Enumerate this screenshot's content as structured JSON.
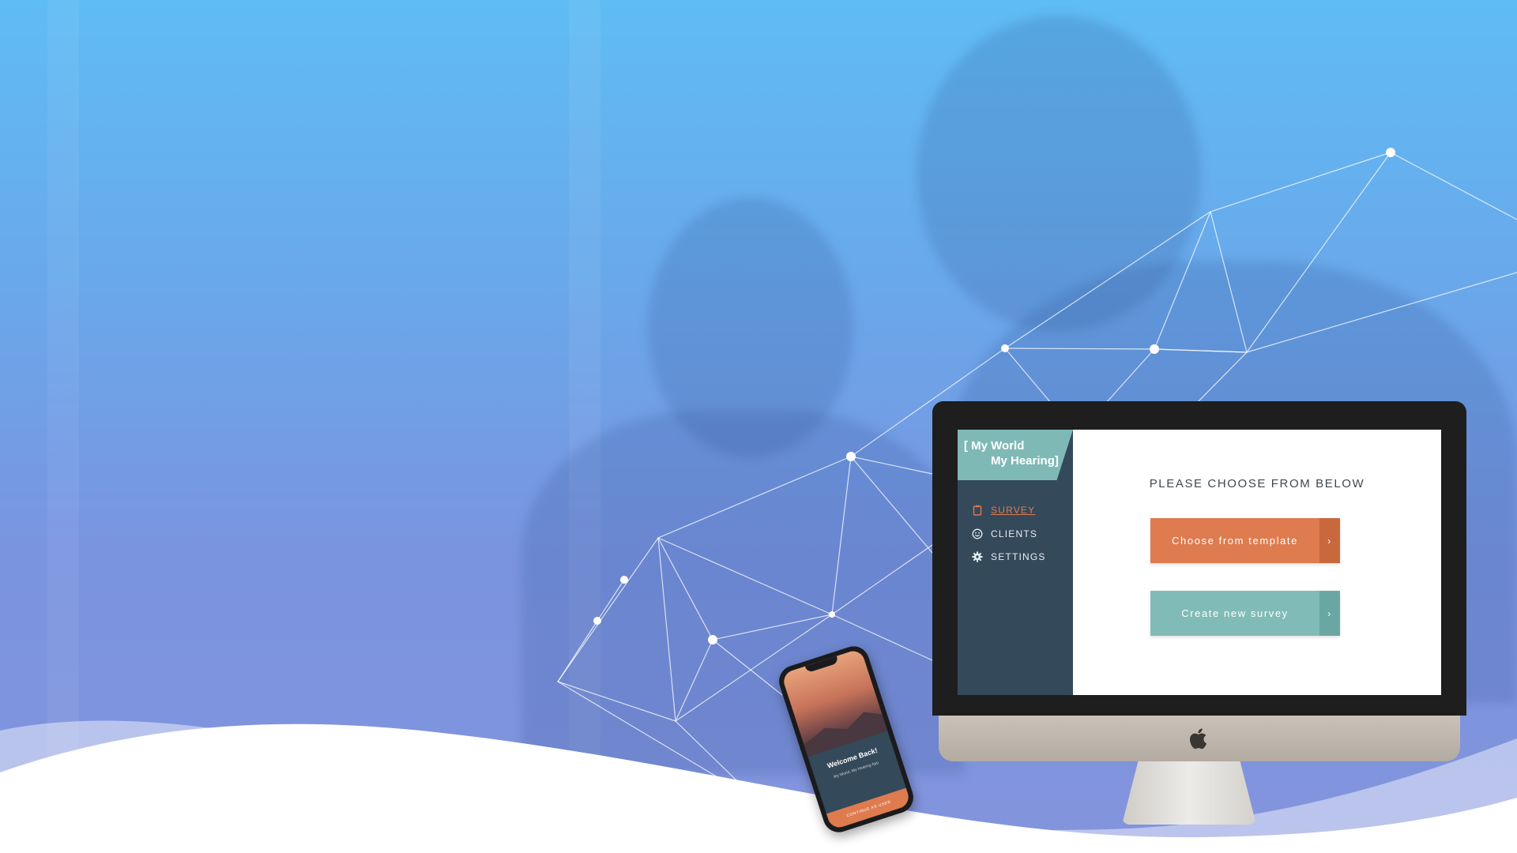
{
  "colors": {
    "accent_orange": "#de7b4f",
    "accent_teal": "#80bbb7",
    "sidebar": "#34495a",
    "background_top": "#5fbcf4",
    "background_bottom": "#8394dc"
  },
  "app": {
    "brand_line1": "[ My World",
    "brand_line2": "My Hearing]",
    "nav": [
      {
        "label": "SURVEY",
        "icon": "clipboard-icon",
        "active": true
      },
      {
        "label": "CLIENTS",
        "icon": "smiley-icon",
        "active": false
      },
      {
        "label": "SETTINGS",
        "icon": "gear-icon",
        "active": false
      }
    ],
    "prompt": "PLEASE CHOOSE FROM BELOW",
    "buttons": [
      {
        "label": "Choose from template",
        "arrow": "›"
      },
      {
        "label": "Create new survey",
        "arrow": "›"
      }
    ]
  },
  "phone": {
    "welcome": "Welcome Back!",
    "subtitle": "My World, My Hearing App",
    "button": "CONTINUE AS USER"
  }
}
